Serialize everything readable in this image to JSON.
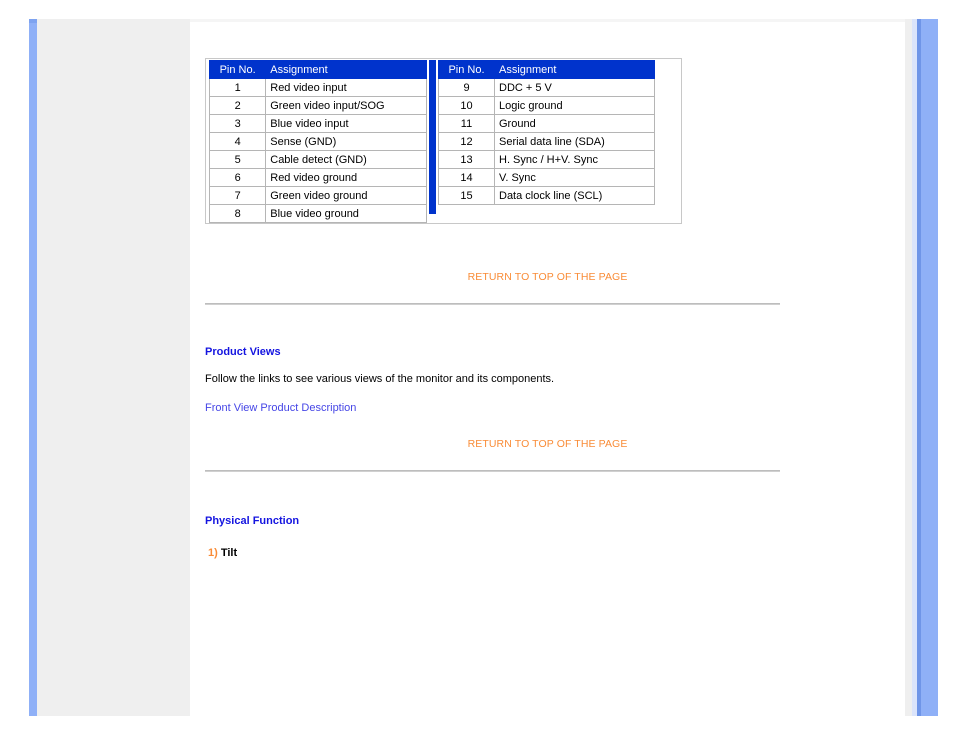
{
  "page": {
    "background": "#ffffff",
    "panel_bg": "#efefef",
    "content_bg": "#ffffff",
    "rail_blue": "#8fb0f7"
  },
  "colors": {
    "table_header_bg": "#0033cc",
    "table_header_text": "#ffffff",
    "heading_blue": "#1414e0",
    "link_blue": "#4646e6",
    "accent_orange": "#f98c37",
    "divider_blue": "#0033cc"
  },
  "pin_table": {
    "columns": [
      "Pin No.",
      "Assignment"
    ],
    "left": {
      "header": {
        "pin": "Pin No.",
        "assignment": "Assignment"
      },
      "rows": [
        {
          "pin": "1",
          "assignment": "Red video input"
        },
        {
          "pin": "2",
          "assignment": "Green video input/SOG"
        },
        {
          "pin": "3",
          "assignment": "Blue video input"
        },
        {
          "pin": "4",
          "assignment": "Sense (GND)"
        },
        {
          "pin": "5",
          "assignment": "Cable detect (GND)"
        },
        {
          "pin": "6",
          "assignment": "Red video ground"
        },
        {
          "pin": "7",
          "assignment": "Green video ground"
        },
        {
          "pin": "8",
          "assignment": "Blue video ground"
        }
      ]
    },
    "right": {
      "header": {
        "pin": "Pin No.",
        "assignment": "Assignment"
      },
      "rows": [
        {
          "pin": "9",
          "assignment": "DDC + 5 V"
        },
        {
          "pin": "10",
          "assignment": "Logic ground"
        },
        {
          "pin": "11",
          "assignment": "Ground"
        },
        {
          "pin": "12",
          "assignment": "Serial data line (SDA)"
        },
        {
          "pin": "13",
          "assignment": "H. Sync / H+V. Sync"
        },
        {
          "pin": "14",
          "assignment": "V. Sync"
        },
        {
          "pin": "15",
          "assignment": "Data clock line (SCL)"
        }
      ]
    }
  },
  "return_top_1": {
    "label": "RETURN TO TOP OF THE PAGE"
  },
  "return_top_2": {
    "label": "RETURN TO TOP OF THE PAGE"
  },
  "product_views": {
    "heading": "Product Views",
    "body": "Follow the links to see various views of the monitor and its components.",
    "link": "Front View Product Description"
  },
  "physical_function": {
    "heading": "Physical Function",
    "items": [
      {
        "number": "1)",
        "label": "Tilt"
      }
    ]
  }
}
